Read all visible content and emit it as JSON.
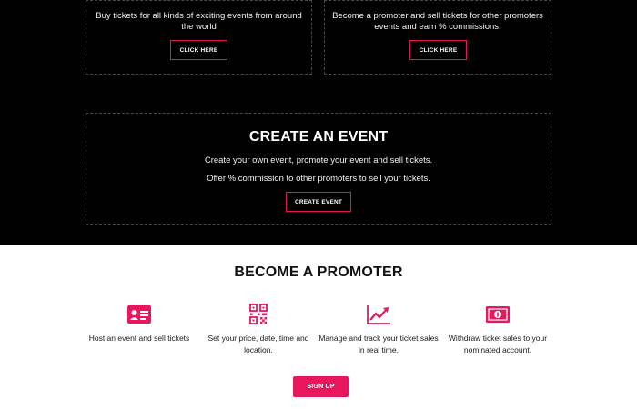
{
  "buy_section": {
    "description": "Buy tickets for all kinds of exciting events from around the world",
    "button_label": "CLICK HERE"
  },
  "promoter_section": {
    "description": "Become a promoter and sell tickets for other promoters events and earn % commissions.",
    "button_label": "CLICK HERE"
  },
  "create_event": {
    "title": "CREATE AN EVENT",
    "line1": "Create your own event, promote your event and sell tickets.",
    "line2": "Offer % commission to other promoters to sell your tickets.",
    "button_label": "CREATE EVENT"
  },
  "become_promoter": {
    "title": "BECOME A PROMOTER",
    "features": [
      {
        "icon": "id-card-icon",
        "text": "Host an event and sell tickets"
      },
      {
        "icon": "qr-code-icon",
        "text": "Set your price, date, time and location."
      },
      {
        "icon": "trend-chart-icon",
        "text": "Manage and track your ticket sales in real time."
      },
      {
        "icon": "money-icon",
        "text": "Withdraw ticket sales to your nominated account."
      }
    ],
    "signup_label": "SIGN UP"
  },
  "colors": {
    "accent": "#e8175d",
    "dark_bg": "#000000",
    "light_bg": "#ffffff"
  }
}
